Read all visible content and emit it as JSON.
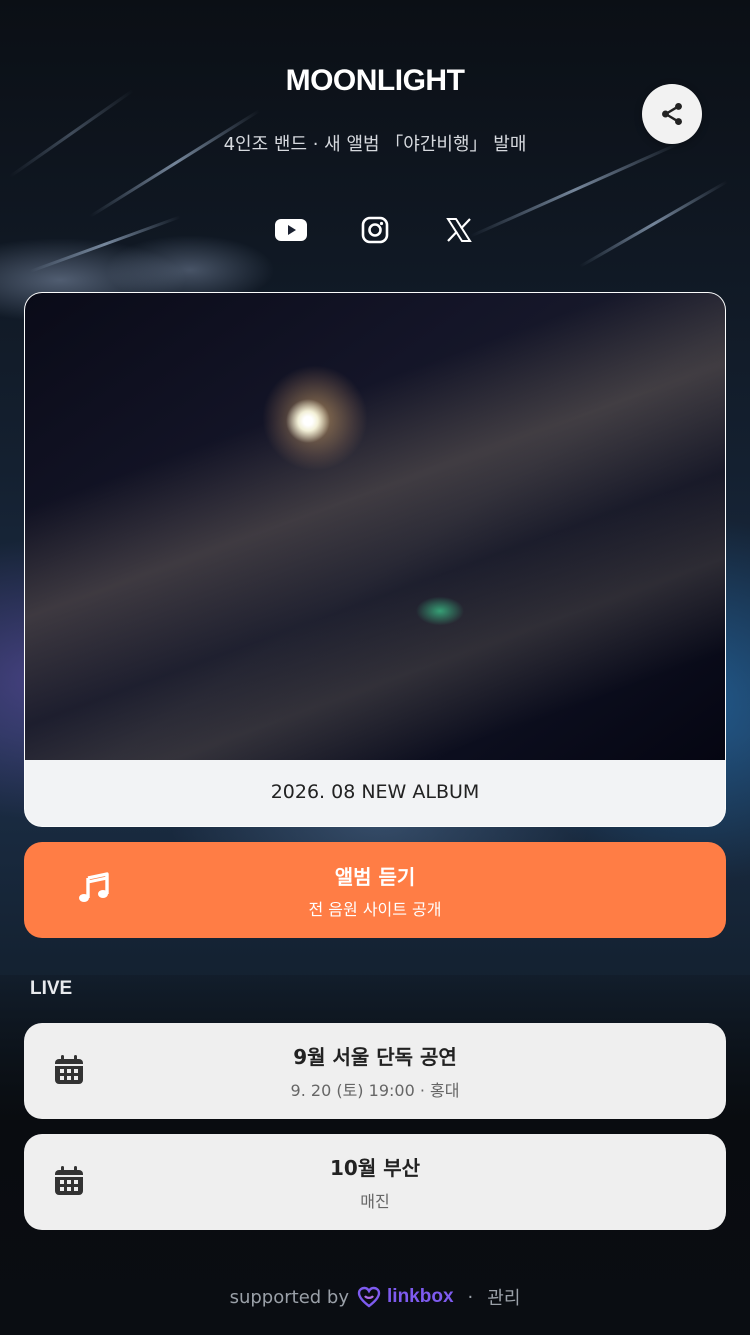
{
  "profile": {
    "name": "MOONLIGHT",
    "bio": "4인조 밴드 · 새 앨범 「야간비행」 발매"
  },
  "social": [
    "youtube-icon",
    "instagram-icon",
    "x-icon"
  ],
  "album": {
    "caption": "2026. 08 NEW ALBUM"
  },
  "listen": {
    "title": "앨범 듣기",
    "subtitle": "전 음원 사이트 공개",
    "color": "#ff7d45"
  },
  "live": {
    "heading": "LIVE",
    "events": [
      {
        "title": "9월 서울 단독 공연",
        "subtitle": "9. 20 (토) 19:00 · 홍대"
      },
      {
        "title": "10월 부산",
        "subtitle": "매진"
      }
    ]
  },
  "footer": {
    "supported_by": "supported by",
    "brand": "linkbox",
    "brand_color": "#7e5bef",
    "separator": "·",
    "manage": "관리"
  }
}
